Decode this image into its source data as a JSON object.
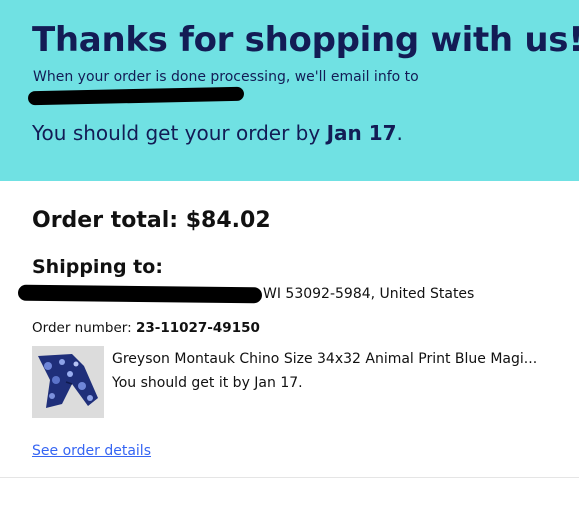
{
  "banner": {
    "headline": "Thanks for shopping with us!",
    "email_note": "When your order is done processing, we'll email info to",
    "eta_prefix": "You should get your order by ",
    "eta_date": "Jan 17",
    "eta_suffix": "."
  },
  "order": {
    "total_label": "Order total: ",
    "total_value": "$84.02",
    "shipping_heading": "Shipping to:",
    "address_visible": "WI 53092-5984, United States",
    "number_label": "Order number: ",
    "number_value": "23-11027-49150"
  },
  "item": {
    "thumbnail_icon": "pants-thumbnail",
    "title": "Greyson Montauk Chino Size 34x32 Animal Print Blue Magi...",
    "eta": "You should get it by Jan 17."
  },
  "links": {
    "order_details": "See order details"
  },
  "colors": {
    "banner_bg": "#70e1e3",
    "banner_text": "#131c55",
    "link": "#3665f3"
  }
}
